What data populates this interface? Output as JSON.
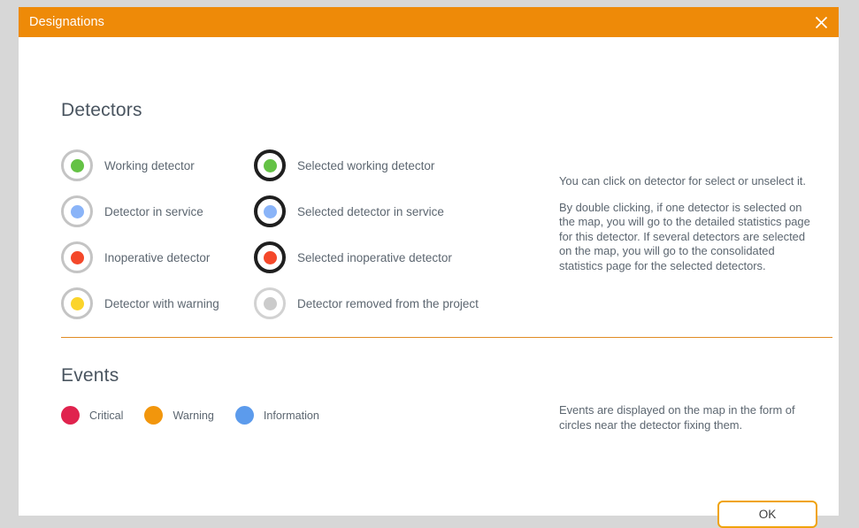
{
  "dialog": {
    "title": "Designations",
    "close_icon": "close-icon",
    "title_bar_color": "#ee8a08"
  },
  "detectors": {
    "heading": "Detectors",
    "items": [
      {
        "label": "Working detector",
        "dot_color": "#64c245",
        "ring": "normal",
        "icon": "detector-working-icon"
      },
      {
        "label": "Selected working detector",
        "dot_color": "#64c245",
        "ring": "selected",
        "icon": "detector-selected-working-icon"
      },
      {
        "label": "Detector in service",
        "dot_color": "#8ab4f8",
        "ring": "normal",
        "icon": "detector-in-service-icon"
      },
      {
        "label": "Selected detector in service",
        "dot_color": "#8ab4f8",
        "ring": "selected",
        "icon": "detector-selected-in-service-icon"
      },
      {
        "label": "Inoperative detector",
        "dot_color": "#f4482a",
        "ring": "normal",
        "icon": "detector-inoperative-icon"
      },
      {
        "label": "Selected inoperative detector",
        "dot_color": "#f4482a",
        "ring": "selected",
        "icon": "detector-selected-inoperative-icon"
      },
      {
        "label": "Detector with warning",
        "dot_color": "#fbd42a",
        "ring": "normal",
        "icon": "detector-warning-icon"
      },
      {
        "label": "Detector removed from the project",
        "dot_color": "#cbcbcb",
        "ring": "removed",
        "icon": "detector-removed-icon"
      }
    ],
    "help": [
      "You can click on detector for select or unselect it.",
      "By double clicking, if one detector is selected on the map, you will go to the detailed statistics page for this detector. If several detectors are selected on the map, you will go to the consolidated statistics page for the selected detectors."
    ]
  },
  "events": {
    "heading": "Events",
    "items": [
      {
        "label": "Critical",
        "color": "#e0234e",
        "icon": "event-critical-icon"
      },
      {
        "label": "Warning",
        "color": "#f2960c",
        "icon": "event-warning-icon"
      },
      {
        "label": "Information",
        "color": "#5c9bec",
        "icon": "event-information-icon"
      }
    ],
    "help": [
      "Events are displayed on the map in the form of circles near the detector fixing them."
    ]
  },
  "footer": {
    "ok_label": "OK",
    "ok_border_color": "#f0a30a"
  }
}
